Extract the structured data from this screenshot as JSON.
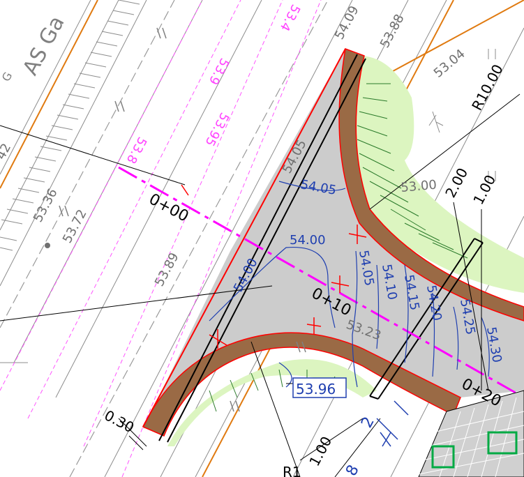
{
  "drawing": {
    "background_color": "#ffffff",
    "layers": {
      "roadway_fill_color": "#cccccc",
      "curb_color": "#9a6a45",
      "grass_color": "#dcf5c0",
      "edge_color": "#ff0000",
      "centerline_color": "#ff00ff",
      "orange_line_color": "#e07a10",
      "blue_contour_color": "#1f3fb0",
      "pink_label_color": "#ff44ff",
      "gray_label_color": "#707070",
      "pavers_color": "#d0d0d0"
    },
    "stations": [
      {
        "id": "sta-0",
        "text": "0+00"
      },
      {
        "id": "sta-10",
        "text": "0+10"
      },
      {
        "id": "sta-20",
        "text": "0+20"
      }
    ],
    "elevation_labels_gray": [
      {
        "id": "e1",
        "text": "53.36"
      },
      {
        "id": "e2",
        "text": "53.72"
      },
      {
        "id": "e3",
        "text": "53.89"
      },
      {
        "id": "e4",
        "text": "54.09"
      },
      {
        "id": "e5",
        "text": "53.88"
      },
      {
        "id": "e6",
        "text": "53.04"
      },
      {
        "id": "e7",
        "text": "53.00"
      },
      {
        "id": "e8",
        "text": "54.05"
      },
      {
        "id": "e9",
        "text": "42"
      },
      {
        "id": "e10",
        "text": "53.23"
      }
    ],
    "elevation_labels_pink": [
      {
        "id": "p1",
        "text": "53.8"
      },
      {
        "id": "p2",
        "text": "53.95"
      },
      {
        "id": "p3",
        "text": "53.9"
      },
      {
        "id": "p4",
        "text": "53.4"
      }
    ],
    "contour_labels_blue": [
      {
        "id": "b1",
        "text": "54.05"
      },
      {
        "id": "b2",
        "text": "54.00"
      },
      {
        "id": "b3",
        "text": "54.00"
      },
      {
        "id": "b4",
        "text": "54.05"
      },
      {
        "id": "b5",
        "text": "54.10"
      },
      {
        "id": "b6",
        "text": "54.15"
      },
      {
        "id": "b7",
        "text": "54.20"
      },
      {
        "id": "b8",
        "text": "54.25"
      },
      {
        "id": "b9",
        "text": "54.30"
      }
    ],
    "boxed_label": {
      "text": "53.96"
    },
    "dimensions": [
      {
        "id": "d1",
        "text": "R10.00"
      },
      {
        "id": "d2",
        "text": "2.00"
      },
      {
        "id": "d3",
        "text": "1.00"
      },
      {
        "id": "d4",
        "text": "0.30"
      },
      {
        "id": "d5",
        "text": "1.00"
      },
      {
        "id": "d6",
        "text": "R1"
      },
      {
        "id": "d7",
        "text": "2"
      },
      {
        "id": "d8",
        "text": "8"
      }
    ],
    "street_name": {
      "text": "AS Ga"
    },
    "misc_labels": [
      {
        "id": "m1",
        "text": "G"
      }
    ]
  }
}
